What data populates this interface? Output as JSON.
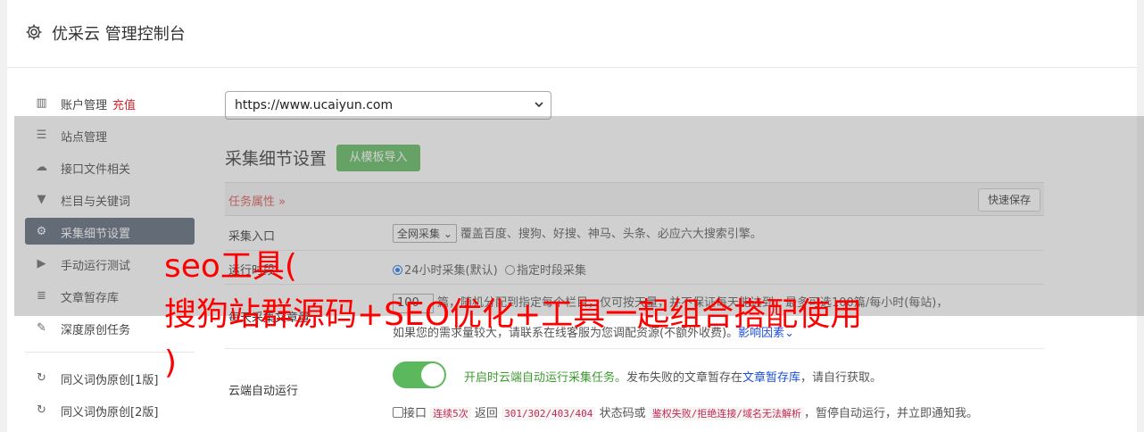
{
  "header": {
    "title": "优采云 管理控制台",
    "icon": "gear-icon"
  },
  "sidebar": {
    "items": [
      {
        "label": "账户管理",
        "extra": "充值",
        "icon": "bar-chart-icon",
        "glyph": "▥"
      },
      {
        "label": "站点管理",
        "icon": "server-icon",
        "glyph": "☰"
      },
      {
        "label": "接口文件相关",
        "icon": "cloud-upload-icon",
        "glyph": "☁"
      },
      {
        "label": "栏目与关键词",
        "icon": "filter-icon",
        "glyph": "▼"
      },
      {
        "label": "采集细节设置",
        "icon": "gears-icon",
        "glyph": "⚙"
      },
      {
        "label": "手动运行测试",
        "icon": "play-circle-icon",
        "glyph": "▶"
      },
      {
        "label": "文章暂存库",
        "icon": "database-icon",
        "glyph": "≣"
      },
      {
        "label": "深度原创任务",
        "icon": "edit-icon",
        "glyph": "✎"
      },
      {
        "label": "同义词伪原创[1版]",
        "icon": "refresh-icon",
        "glyph": "↻"
      },
      {
        "label": "同义词伪原创[2版]",
        "icon": "refresh-icon",
        "glyph": "↻"
      }
    ]
  },
  "site_select": {
    "value": "https://www.ucaiyun.com"
  },
  "section": {
    "title": "采集细节设置",
    "import_label": "从模板导入"
  },
  "task_bar": {
    "label": "任务属性 »",
    "save_label": "快速保存"
  },
  "rows": {
    "entry": {
      "label": "采集入口",
      "select": "全网采集 ⌄",
      "desc": "覆盖百度、搜狗、好搜、神马、头条、必应六大搜索引擎。"
    },
    "runtime": {
      "label": "运行时段",
      "opt1": "24小时采集(默认)",
      "opt2": "指定时段采集"
    },
    "count": {
      "label": "每天采集文章量",
      "value": "100",
      "desc": "篇，随机分配到指定每个栏目，仅可按天量，并不保证每天能达到，最多可选100篇/每小时(每站)，",
      "desc2": "如果您的需求量较大，请联系在线客服为您调配资源(不额外收费)。",
      "link": "影响因素⌄"
    },
    "cloud": {
      "label": "云端自动运行",
      "toggle_on": true,
      "desc_green": "开启时云端自动运行采集任务。",
      "desc_mid": "发布失败的文章暂存在",
      "desc_link": "文章暂存库",
      "desc_end": "，请自行获取。",
      "cb_label": "接口",
      "code1": "连续5次",
      "text_return": "返回",
      "code2": "301/302/403/404",
      "text_status": "状态码或",
      "code3": "鉴权失败/拒绝连接/域名无法解析",
      "text_end": "，暂停自动运行，并立即通知我。"
    }
  },
  "watermark": {
    "line1": "seo工具(",
    "line2": "搜狗站群源码+SEO优化+工具一起组合搭配使用",
    "line3": ")"
  },
  "colors": {
    "active_nav": "#586475",
    "green_button": "#5cb85c",
    "accent_red": "#d9232d",
    "link_blue": "#1a4fd8",
    "watermark_red": "#ff0000"
  }
}
